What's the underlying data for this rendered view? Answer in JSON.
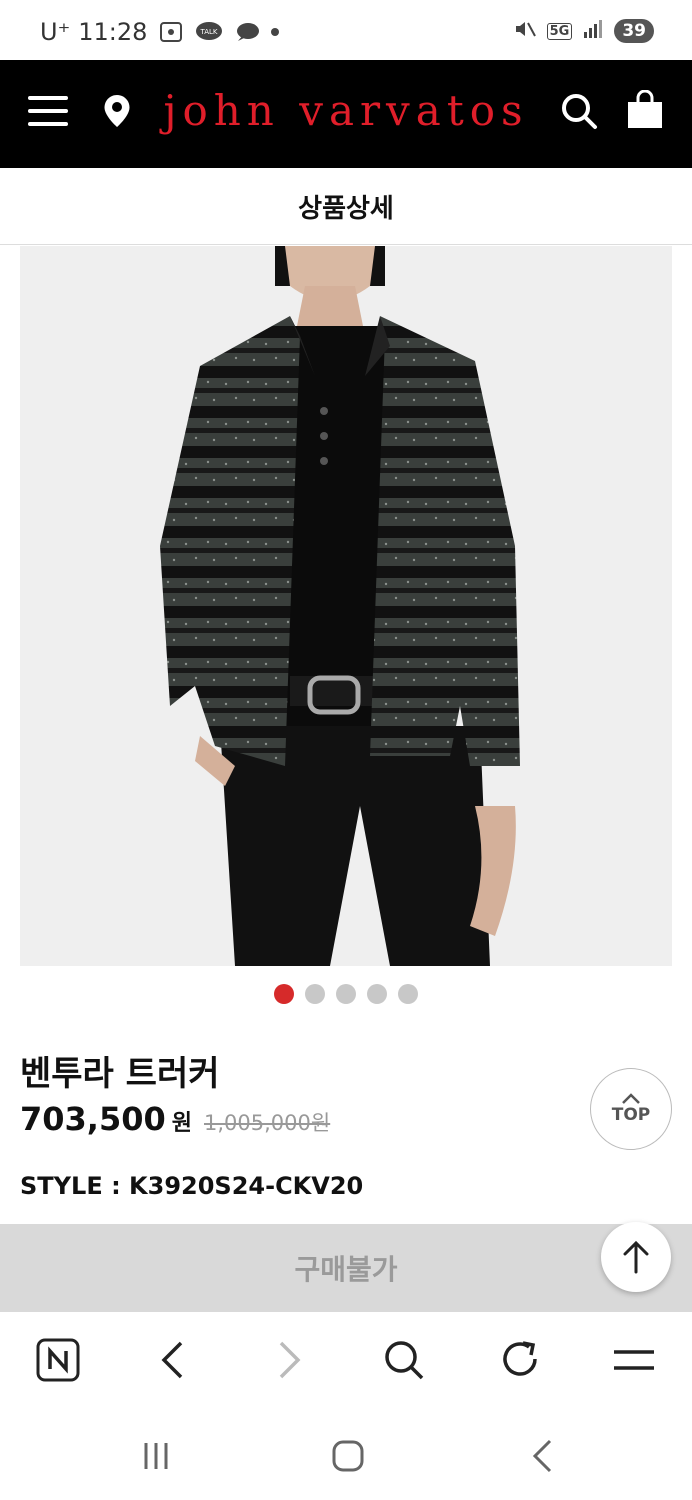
{
  "status_bar": {
    "carrier": "U⁺",
    "time": "11:28",
    "network": "5G",
    "battery": "39"
  },
  "header": {
    "brand": "john varvatos",
    "brand_color": "#e01e2a"
  },
  "page": {
    "title": "상품상세"
  },
  "product": {
    "name": "벤투라 트러커",
    "price": "703,500",
    "currency": "원",
    "original_price": "1,005,000원",
    "style_code": "STYLE : K3920S24-CKV20",
    "image_count": 5,
    "active_image_index": 0
  },
  "buttons": {
    "top": "TOP",
    "buy": "구매불가"
  },
  "icons": {
    "header": [
      "menu-icon",
      "location-pin-icon",
      "search-icon",
      "shopping-bag-icon"
    ],
    "browser": [
      "naver-home-icon",
      "back-icon",
      "forward-icon",
      "search-icon",
      "reload-icon",
      "menu-icon"
    ],
    "system": [
      "recent-apps-icon",
      "home-icon",
      "back-icon"
    ]
  },
  "colors": {
    "accent": "#d62a2a",
    "header_bg": "#000000",
    "disabled_bar": "#d9d9d9"
  }
}
